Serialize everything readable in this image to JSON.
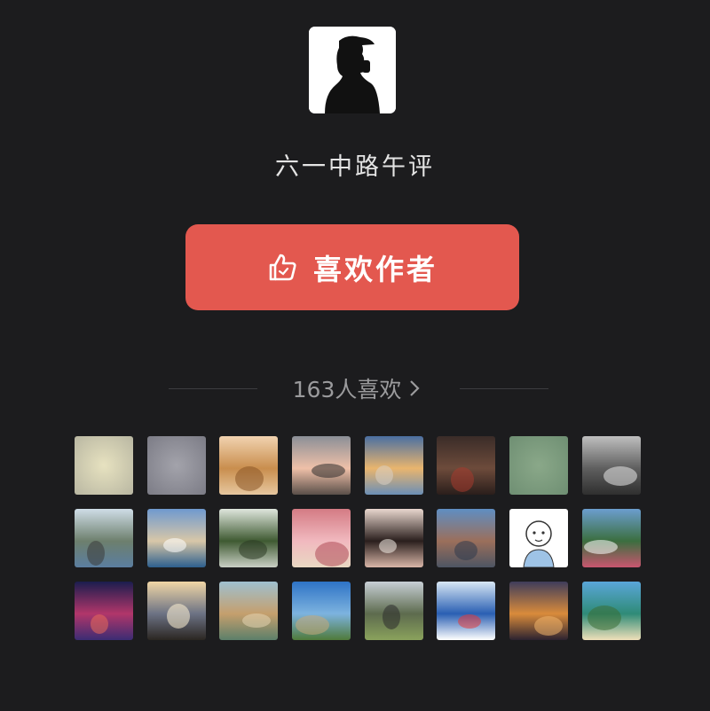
{
  "author": {
    "name": "六一中路午评",
    "avatar_icon": "silhouette-with-cap-icon"
  },
  "like_button": {
    "label": "喜欢作者",
    "icon": "thumbs-up-icon",
    "color": "#e3584f"
  },
  "likes": {
    "text": "163人喜欢",
    "icon": "chevron-right-icon"
  },
  "likers": [
    {
      "name": "liker-avatar-1",
      "kind": "blur",
      "c1": "#e7e2c0",
      "c2": "#b9b7a2"
    },
    {
      "name": "liker-avatar-2",
      "kind": "blur",
      "c1": "#a3a3ab",
      "c2": "#7c7c86"
    },
    {
      "name": "liker-avatar-3",
      "kind": "photo",
      "sky": "#f1d3b0",
      "mid": "#c98e4e",
      "ground": "#e6c79f",
      "accent": "#8a5526"
    },
    {
      "name": "liker-avatar-4",
      "kind": "photo",
      "sky": "#8b8f97",
      "mid": "#efc0a8",
      "ground": "#5a4f49",
      "accent": "#2b2b2b"
    },
    {
      "name": "liker-avatar-5",
      "kind": "photo",
      "sky": "#4a6fa2",
      "mid": "#e9b56e",
      "ground": "#6c8fb6",
      "accent": "#d8d0c4"
    },
    {
      "name": "liker-avatar-6",
      "kind": "photo",
      "sky": "#3a2c28",
      "mid": "#6d4b3b",
      "ground": "#2a1e1b",
      "accent": "#a53a2e"
    },
    {
      "name": "liker-avatar-7",
      "kind": "blur",
      "c1": "#8aa889",
      "c2": "#6f8f73"
    },
    {
      "name": "liker-avatar-8",
      "kind": "photo",
      "sky": "#bfbfbf",
      "mid": "#5f5f5f",
      "ground": "#2f2f2f",
      "accent": "#e8e8e8"
    },
    {
      "name": "liker-avatar-9",
      "kind": "photo",
      "sky": "#cfdde7",
      "mid": "#6d7f6d",
      "ground": "#5b7ea0",
      "accent": "#3b3b3b"
    },
    {
      "name": "liker-avatar-10",
      "kind": "photo",
      "sky": "#6f99cf",
      "mid": "#d8c7a8",
      "ground": "#2d5f8e",
      "accent": "#ffffff"
    },
    {
      "name": "liker-avatar-11",
      "kind": "photo",
      "sky": "#dfe6dd",
      "mid": "#3f5a32",
      "ground": "#c9cfc4",
      "accent": "#2c3b25"
    },
    {
      "name": "liker-avatar-12",
      "kind": "photo",
      "sky": "#d47b84",
      "mid": "#f1b9bf",
      "ground": "#e9d8c2",
      "accent": "#b04a57"
    },
    {
      "name": "liker-avatar-13",
      "kind": "photo",
      "sky": "#e9d7ce",
      "mid": "#2a1f1d",
      "ground": "#d9b6a8",
      "accent": "#f4ece6"
    },
    {
      "name": "liker-avatar-14",
      "kind": "photo",
      "sky": "#5f8ec2",
      "mid": "#9b6f5b",
      "ground": "#4d5563",
      "accent": "#2f3b4c"
    },
    {
      "name": "liker-avatar-15",
      "kind": "sketch",
      "sky": "#ffffff",
      "mid": "#9ec3e6",
      "ground": "#f7f7f7",
      "accent": "#333333"
    },
    {
      "name": "liker-avatar-16",
      "kind": "photo",
      "sky": "#6c9ecf",
      "mid": "#3b6e3f",
      "ground": "#c8566f",
      "accent": "#ffffff"
    },
    {
      "name": "liker-avatar-17",
      "kind": "photo",
      "sky": "#1b1d4e",
      "mid": "#b1366a",
      "ground": "#3b2c73",
      "accent": "#e86a5a"
    },
    {
      "name": "liker-avatar-18",
      "kind": "photo",
      "sky": "#f0d6a6",
      "mid": "#6c7284",
      "ground": "#2b2621",
      "accent": "#fff3d4"
    },
    {
      "name": "liker-avatar-19",
      "kind": "photo",
      "sky": "#9fc0cf",
      "mid": "#c59f6d",
      "ground": "#5c7f6a",
      "accent": "#e3d4b3"
    },
    {
      "name": "liker-avatar-20",
      "kind": "photo",
      "sky": "#2e73c6",
      "mid": "#7db3df",
      "ground": "#4f7a3a",
      "accent": "#c7a97a"
    },
    {
      "name": "liker-avatar-21",
      "kind": "photo",
      "sky": "#c8cfd6",
      "mid": "#5d6b4e",
      "ground": "#8aa25c",
      "accent": "#2b2b2b"
    },
    {
      "name": "liker-avatar-22",
      "kind": "photo",
      "sky": "#d8e7f4",
      "mid": "#2a5fb3",
      "ground": "#ffffff",
      "accent": "#e33b3b"
    },
    {
      "name": "liker-avatar-23",
      "kind": "photo",
      "sky": "#3f3d5b",
      "mid": "#d98b3b",
      "ground": "#2b2230",
      "accent": "#f1b56b"
    },
    {
      "name": "liker-avatar-24",
      "kind": "photo",
      "sky": "#5aa6d9",
      "mid": "#2f8b77",
      "ground": "#efe0b9",
      "accent": "#3a6e34"
    }
  ]
}
